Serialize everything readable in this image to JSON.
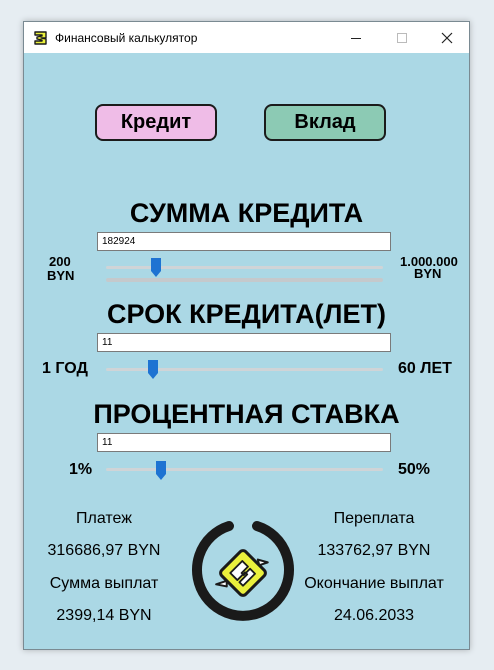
{
  "window": {
    "title": "Финансовый калькулятор",
    "controls": {
      "minimize": "—",
      "maximize": "☐",
      "close": "✕"
    }
  },
  "buttons": {
    "credit": "Кредит",
    "deposit": "Вклад"
  },
  "amount": {
    "heading": "СУММА КРЕДИТА",
    "value": "182924",
    "min_value": "200",
    "min_unit": "BYN",
    "max_value": "1.000.000",
    "max_unit": "BYN",
    "slider_fraction": 0.18
  },
  "term": {
    "heading": "СРОК КРЕДИТА(ЛЕТ)",
    "value": "11",
    "min_label": "1 ГОД",
    "max_label": "60 ЛЕТ",
    "slider_fraction": 0.17
  },
  "rate": {
    "heading": "ПРОЦЕНТНАЯ СТАВКА",
    "value": "11",
    "min_label": "1%",
    "max_label": "50%",
    "slider_fraction": 0.2
  },
  "results": {
    "payment_label": "Платеж",
    "payment_value": "316686,97 BYN",
    "overpayment_label": "Переплата",
    "overpayment_value": "133762,97 BYN",
    "total_label": "Сумма выплат",
    "total_value": "2399,14 BYN",
    "end_label": "Окончание выплат",
    "end_value": "24.06.2033"
  },
  "colors": {
    "window_bg": "#abd8e5",
    "credit_button": "#efbce7",
    "deposit_button": "#8ccab4",
    "slider_thumb": "#1e73d2",
    "logo_yellow": "#eaf03c"
  }
}
